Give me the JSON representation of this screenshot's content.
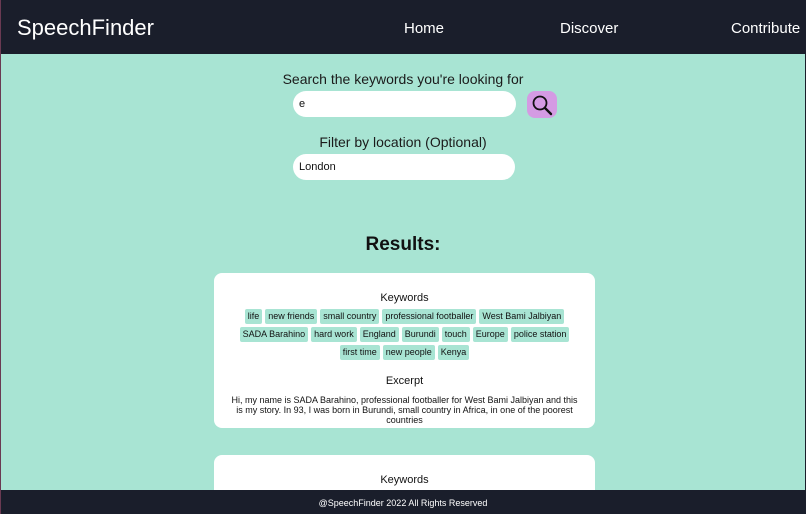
{
  "header": {
    "brand": "SpeechFinder",
    "nav": {
      "home": "Home",
      "discover": "Discover",
      "contribute": "Contribute"
    }
  },
  "search": {
    "label": "Search the keywords you're looking for",
    "value": "e",
    "button_icon": "magnifying-glass-icon"
  },
  "filter": {
    "label": "Filter by location (Optional)",
    "value": "London"
  },
  "results": {
    "title": "Results:",
    "cards": [
      {
        "keywords_heading": "Keywords",
        "keywords": [
          "life",
          "new friends",
          "small country",
          "professional footballer",
          "West Bami Jalbiyan",
          "SADA Barahino",
          "hard work",
          "England",
          "Burundi",
          "touch",
          "Europe",
          "police station",
          "first time",
          "new people",
          "Kenya"
        ],
        "excerpt_heading": "Excerpt",
        "excerpt": "Hi, my name is SADA Barahino, professional footballer for West Bami Jalbiyan and this is my story. In 93, I was born in Burundi, small country in Africa, in one of the poorest countries"
      },
      {
        "keywords_heading": "Keywords"
      }
    ]
  },
  "footer": {
    "text": "@SpeechFinder 2022 All Rights Reserved"
  },
  "colors": {
    "header_bg": "#1a1e2b",
    "page_bg": "#a8e4d3",
    "search_button": "#d49be3",
    "tag_bg": "#a8e4d3"
  }
}
